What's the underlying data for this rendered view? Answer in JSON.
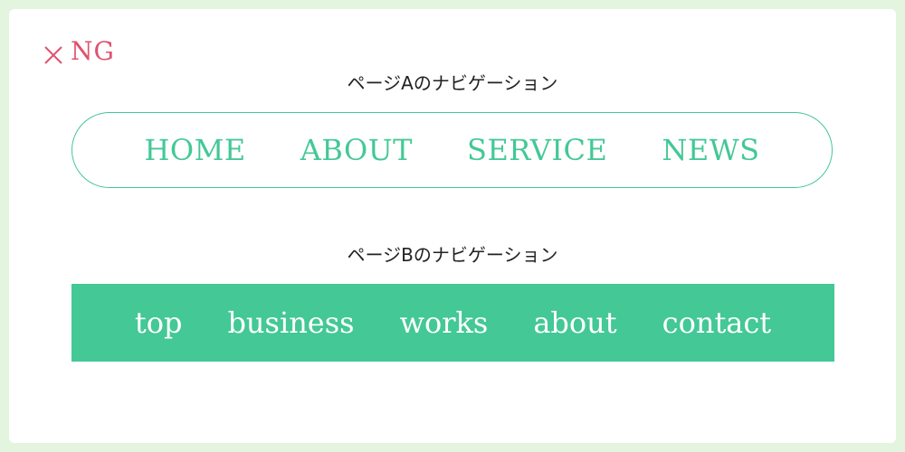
{
  "badge": {
    "label": "NG",
    "icon": "close-icon",
    "color": "#e0526f"
  },
  "page_a": {
    "caption": "ページAのナビゲーション",
    "accent": "#43c896",
    "nav": [
      {
        "label": "HOME"
      },
      {
        "label": "ABOUT"
      },
      {
        "label": "SERVICE"
      },
      {
        "label": "NEWS"
      }
    ]
  },
  "page_b": {
    "caption": "ページBのナビゲーション",
    "background": "#43c896",
    "nav": [
      {
        "label": "top"
      },
      {
        "label": "business"
      },
      {
        "label": "works"
      },
      {
        "label": "about"
      },
      {
        "label": "contact"
      }
    ]
  }
}
